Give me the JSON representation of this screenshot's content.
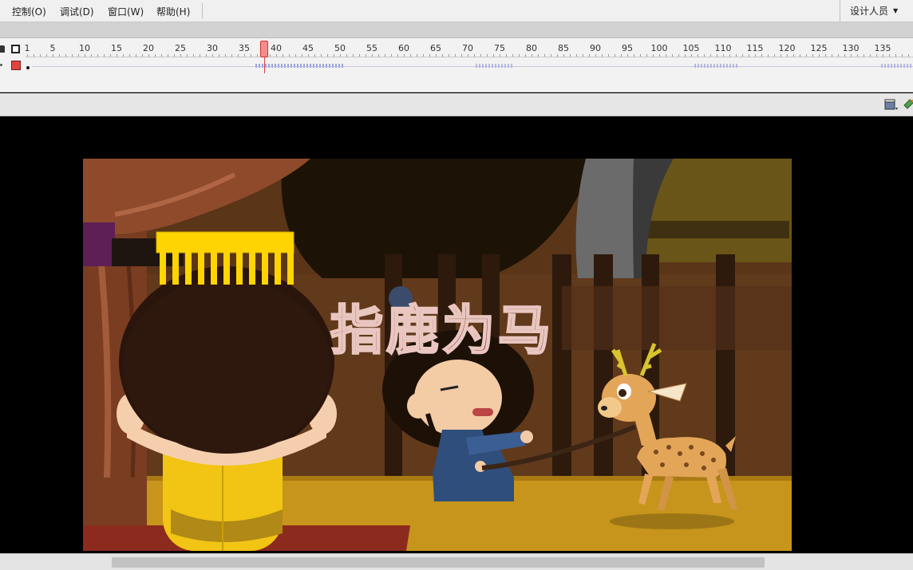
{
  "menu": {
    "items": [
      {
        "label": "控制(O)"
      },
      {
        "label": "调试(D)"
      },
      {
        "label": "窗口(W)"
      },
      {
        "label": "帮助(H)"
      }
    ],
    "workspace_label": "设计人员"
  },
  "timeline": {
    "current_frame": 37,
    "ruler_labels": [
      "1",
      "5",
      "10",
      "15",
      "20",
      "25",
      "30",
      "35",
      "40",
      "45",
      "50",
      "55",
      "60",
      "65",
      "70",
      "75",
      "80",
      "85",
      "90",
      "95",
      "100",
      "105",
      "110",
      "115",
      "120",
      "125",
      "130",
      "135"
    ]
  },
  "stage": {
    "title_text": "指鹿为马",
    "colors": {
      "curtain": "#8e4a2b",
      "floor": "#c7951c",
      "title_fill": "#8b4a43",
      "robe_blue": "#2f4e7c",
      "emperor_robe": "#f2c414",
      "deer": "#e3a659"
    }
  },
  "icons": [
    "lock-icon",
    "outline-icon",
    "edit-scene-icon",
    "edit-symbol-icon",
    "caret-down-icon"
  ]
}
